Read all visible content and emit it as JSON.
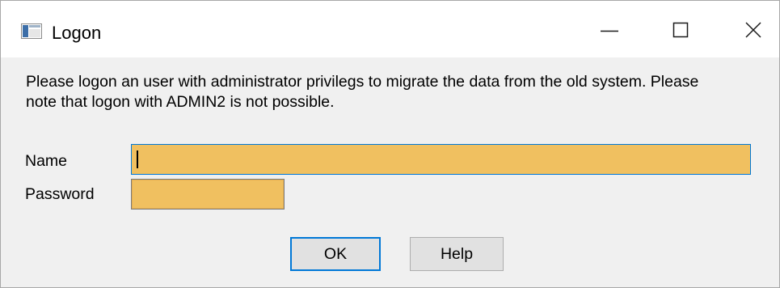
{
  "window": {
    "title": "Logon",
    "controls": {
      "minimize": "minimize-icon",
      "maximize": "maximize-icon",
      "close": "close-icon"
    }
  },
  "message": "Please logon an user with administrator privilegs to migrate the data from the old system. Please\nnote that logon with ADMIN2 is not possible.",
  "form": {
    "name_label": "Name",
    "name_value": "",
    "password_label": "Password",
    "password_value": ""
  },
  "buttons": {
    "ok_label": "OK",
    "help_label": "Help"
  },
  "colors": {
    "field_background": "#f0c060",
    "focus_border": "#0078d7",
    "dialog_background": "#f0f0f0",
    "titlebar_background": "#ffffff"
  }
}
